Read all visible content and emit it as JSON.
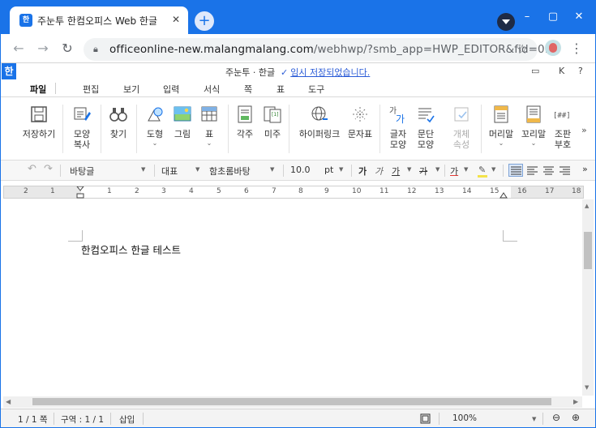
{
  "browser": {
    "tab_title": "주눈투  한컴오피스 Web 한글",
    "tab_favicon": "한",
    "new_tab_label": "+",
    "url_host": "officeonline-new.malangmalang.com",
    "url_path": "/webhwp/?smb_app=HWP_EDITOR&fid=0...",
    "window_controls": {
      "minimize": "–",
      "maximize": "▢",
      "close": "✕"
    }
  },
  "app": {
    "logo": "한",
    "doc_title": "주눈투 · 한글",
    "save_status": "임시 저장되었습니다.",
    "right_icons": {
      "help": "?",
      "k": "K"
    }
  },
  "menu": [
    "파일",
    "편집",
    "보기",
    "입력",
    "서식",
    "쪽",
    "표",
    "도구"
  ],
  "ribbon": [
    {
      "label": "저장하기",
      "icon": "save-icon"
    },
    {
      "label": "모양\n복사",
      "icon": "format-painter-icon"
    },
    {
      "label": "찾기",
      "icon": "binoculars-icon"
    },
    {
      "label": "도형",
      "icon": "shape-icon",
      "dropdown": true
    },
    {
      "label": "그림",
      "icon": "picture-icon"
    },
    {
      "label": "표",
      "icon": "table-icon",
      "dropdown": true
    },
    {
      "label": "각주",
      "icon": "footnote-icon"
    },
    {
      "label": "미주",
      "icon": "endnote-icon"
    },
    {
      "label": "하이퍼링크",
      "icon": "hyperlink-icon"
    },
    {
      "label": "문자표",
      "icon": "symbol-icon"
    },
    {
      "label": "글자\n모양",
      "icon": "char-shape-icon"
    },
    {
      "label": "문단\n모양",
      "icon": "para-shape-icon"
    },
    {
      "label": "개체\n속성",
      "icon": "object-props-icon",
      "disabled": true
    },
    {
      "label": "머리말",
      "icon": "header-icon",
      "dropdown": true
    },
    {
      "label": "꼬리말",
      "icon": "footer-icon",
      "dropdown": true
    },
    {
      "label": "조판\n부호",
      "icon": "layout-marks-icon"
    }
  ],
  "ribbon_more": "»",
  "format_bar": {
    "style": "바탕글",
    "font_lang": "대표",
    "font": "함초롬바탕",
    "size": "10.0",
    "unit": "pt",
    "bold": "가",
    "italic": "가",
    "underline": "가",
    "strike": "가",
    "font_color": "가",
    "highlight": "가"
  },
  "ruler_ticks": [
    "2",
    "1",
    "1",
    "2",
    "3",
    "4",
    "5",
    "6",
    "7",
    "8",
    "9",
    "10",
    "11",
    "12",
    "13",
    "14",
    "15",
    "16",
    "17",
    "18"
  ],
  "document": {
    "text": "한컴오피스 한글 테스트"
  },
  "status": {
    "page": "1 / 1 쪽",
    "section": "구역 : 1 / 1",
    "mode": "삽입",
    "zoom": "100%"
  }
}
